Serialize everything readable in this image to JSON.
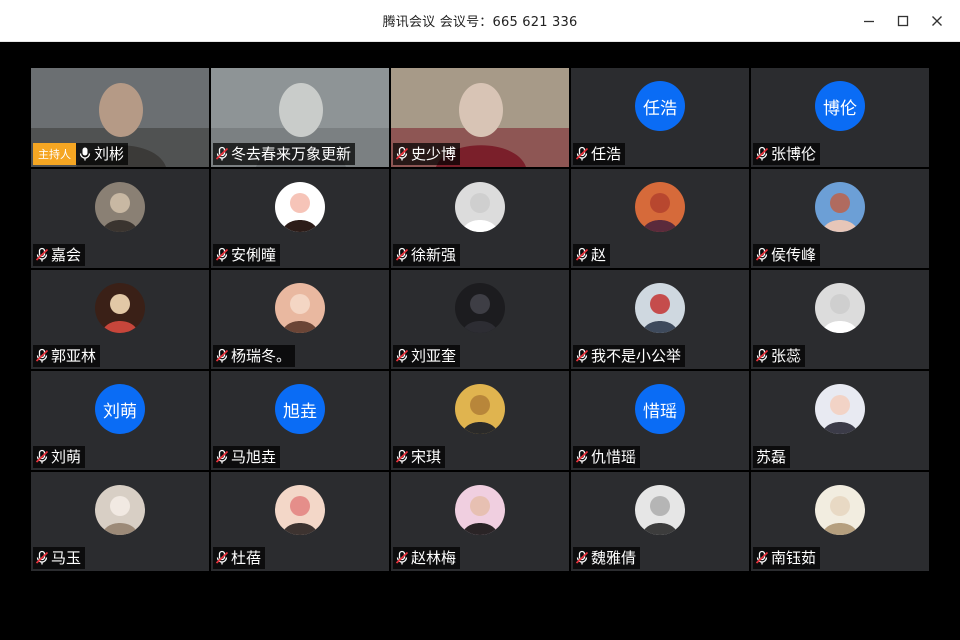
{
  "window": {
    "title": "腾讯会议 会议号：665 621 336"
  },
  "host_badge": "主持人",
  "participants": [
    {
      "name": "刘彬",
      "kind": "video",
      "host": true,
      "muted": false,
      "palette": [
        "#6b6f72",
        "#3b3a38",
        "#b59a86"
      ]
    },
    {
      "name": "冬去春来万象更新",
      "kind": "video",
      "muted": true,
      "palette": [
        "#8e9496",
        "#6b7072",
        "#c9ccca"
      ]
    },
    {
      "name": "史少博",
      "kind": "video",
      "muted": true,
      "palette": [
        "#a79a88",
        "#7a1f2a",
        "#d8c4b5"
      ]
    },
    {
      "name": "任浩",
      "kind": "initials",
      "initials": "任浩",
      "muted": true
    },
    {
      "name": "张博伦",
      "kind": "initials",
      "initials": "博伦",
      "muted": true
    },
    {
      "name": "嘉会",
      "kind": "avatar",
      "muted": true,
      "palette": [
        "#8a8074",
        "#3a342f",
        "#c8b8a3"
      ]
    },
    {
      "name": "安俐曈",
      "kind": "avatar",
      "muted": true,
      "palette": [
        "#ffffff",
        "#2c1c18",
        "#f6c4b8"
      ]
    },
    {
      "name": "徐新强",
      "kind": "avatar",
      "muted": true,
      "palette": [
        "#dcdcdc",
        "#ffffff",
        "#cfcfcf"
      ]
    },
    {
      "name": "赵",
      "kind": "avatar",
      "muted": true,
      "palette": [
        "#d66a3a",
        "#5a2a3c",
        "#b8472f"
      ]
    },
    {
      "name": "侯传峰",
      "kind": "avatar",
      "muted": true,
      "palette": [
        "#6c9fd6",
        "#e7c6b8",
        "#b06b5f"
      ]
    },
    {
      "name": "郭亚林",
      "kind": "avatar",
      "muted": true,
      "palette": [
        "#3a2017",
        "#c7463b",
        "#e2c8a6"
      ]
    },
    {
      "name": "杨瑞冬。",
      "kind": "avatar",
      "muted": true,
      "palette": [
        "#e9b8a0",
        "#6b4536",
        "#f4d6c4"
      ]
    },
    {
      "name": "刘亚奎",
      "kind": "avatar",
      "muted": true,
      "palette": [
        "#1c1c1f",
        "#2d2d33",
        "#3e3e45"
      ]
    },
    {
      "name": "我不是小公举",
      "kind": "avatar",
      "muted": true,
      "palette": [
        "#cfd8e0",
        "#3e4a5c",
        "#c54c4c"
      ]
    },
    {
      "name": "张蕊",
      "kind": "avatar",
      "muted": true,
      "palette": [
        "#dcdcdc",
        "#ffffff",
        "#cfcfcf"
      ]
    },
    {
      "name": "刘萌",
      "kind": "initials",
      "initials": "刘萌",
      "muted": true
    },
    {
      "name": "马旭垚",
      "kind": "initials",
      "initials": "旭垚",
      "muted": true
    },
    {
      "name": "宋琪",
      "kind": "avatar",
      "muted": true,
      "palette": [
        "#e0b44f",
        "#2a2a2a",
        "#b8863a"
      ]
    },
    {
      "name": "仇惜瑶",
      "kind": "initials",
      "initials": "惜瑶",
      "muted": true
    },
    {
      "name": "苏磊",
      "kind": "avatar",
      "muted": false,
      "nomic": true,
      "palette": [
        "#e8eaf2",
        "#3b3b48",
        "#f2d3c6"
      ]
    },
    {
      "name": "马玉",
      "kind": "avatar",
      "muted": true,
      "palette": [
        "#d8cfc5",
        "#9c8a78",
        "#f1e9e2"
      ]
    },
    {
      "name": "杜蓓",
      "kind": "avatar",
      "muted": true,
      "palette": [
        "#f3d7c8",
        "#3d3330",
        "#e58e8a"
      ]
    },
    {
      "name": "赵林梅",
      "kind": "avatar",
      "muted": true,
      "palette": [
        "#f0cfe0",
        "#2a2426",
        "#e7c0b2"
      ]
    },
    {
      "name": "魏雅倩",
      "kind": "avatar",
      "muted": true,
      "palette": [
        "#e6e6e6",
        "#3c3c3c",
        "#b5b5b5"
      ]
    },
    {
      "name": "南钰茹",
      "kind": "avatar",
      "muted": true,
      "palette": [
        "#f2ede0",
        "#b59f7e",
        "#e8d9c4"
      ]
    }
  ],
  "icons": {
    "minimize": "minimize-icon",
    "maximize": "maximize-icon",
    "close": "close-icon",
    "mic": "mic-icon",
    "mic_muted": "mic-muted-icon"
  }
}
